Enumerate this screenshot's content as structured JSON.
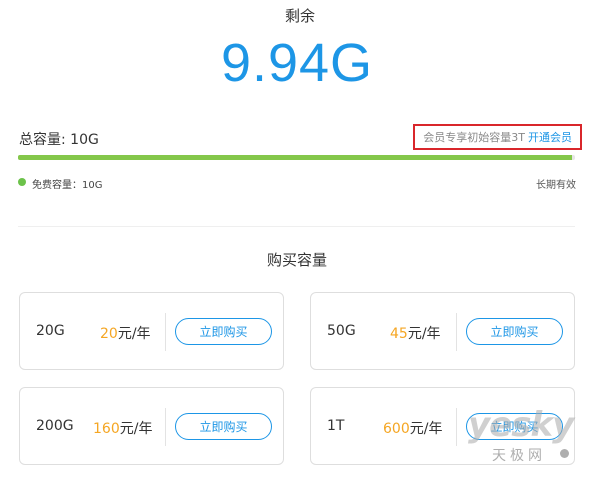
{
  "summary": {
    "remaining_label": "剩余",
    "remaining_value": "9.94G"
  },
  "total": {
    "label": "总容量: 10G",
    "promo_text": "会员专享初始容量3T",
    "promo_link": "开通会员"
  },
  "usage_bar": {
    "used_fraction": 0.006,
    "color": "#84c74a"
  },
  "legend": {
    "free_capacity": "免费容量：10G",
    "validity": "长期有效"
  },
  "purchase": {
    "title": "购买容量",
    "price_unit": "元/年",
    "plans": [
      {
        "size": "20G",
        "price": "20",
        "button": "立即购买"
      },
      {
        "size": "50G",
        "price": "45",
        "button": "立即购买"
      },
      {
        "size": "200G",
        "price": "160",
        "button": "立即购买"
      },
      {
        "size": "1T",
        "price": "600",
        "button": "立即购买"
      }
    ]
  },
  "watermark": {
    "brand": "yesky",
    "brand_cn": "天极网"
  },
  "colors": {
    "accent": "#1d96e6",
    "price": "#f5a623",
    "highlight_border": "#d9262b"
  }
}
